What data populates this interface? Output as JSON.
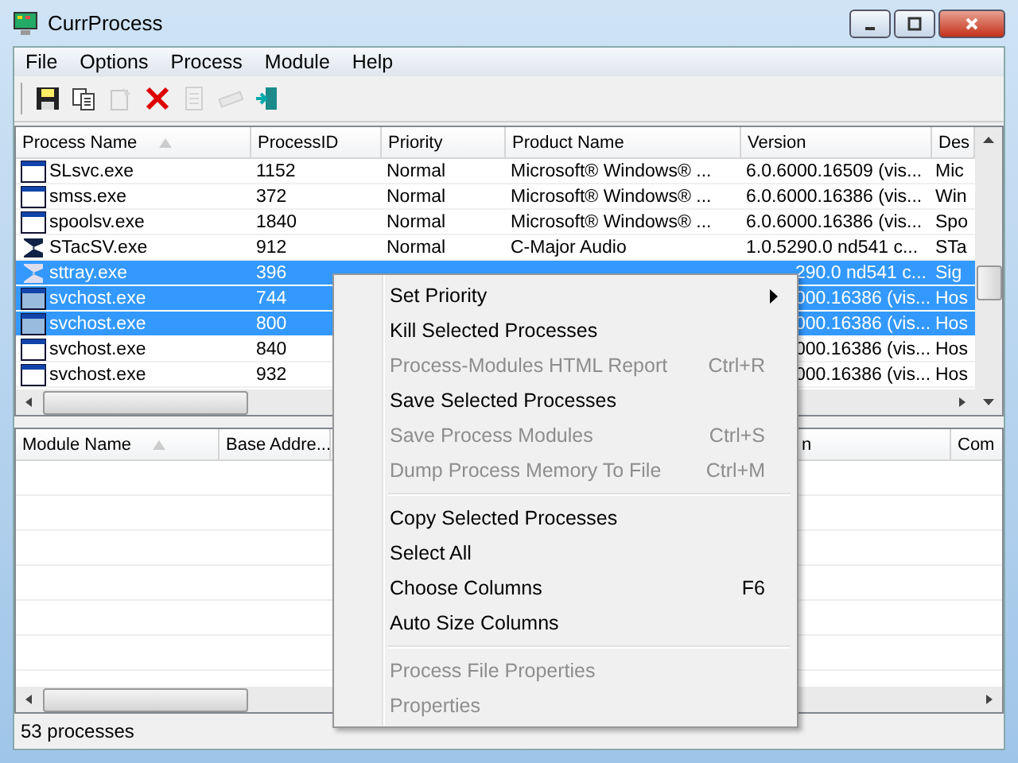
{
  "window": {
    "title": "CurrProcess"
  },
  "menu_bar": [
    "File",
    "Options",
    "Process",
    "Module",
    "Help"
  ],
  "toolbar": [
    {
      "disabled": false
    },
    {
      "disabled": false
    },
    {
      "disabled": true
    },
    {
      "disabled": false
    },
    {
      "disabled": true
    },
    {
      "disabled": true
    },
    {
      "disabled": false
    }
  ],
  "process_table": {
    "columns": [
      {
        "label": "Process Name",
        "sorted": true
      },
      {
        "label": "ProcessID"
      },
      {
        "label": "Priority"
      },
      {
        "label": "Product Name"
      },
      {
        "label": "Version"
      },
      {
        "label": "Des"
      }
    ],
    "rows": [
      {
        "kind": "window",
        "selected": false,
        "covered": false,
        "name": "SLsvc.exe",
        "pid": "1152",
        "priority": "Normal",
        "product": "Microsoft® Windows® ...",
        "version": "6.0.6000.16509 (vis...",
        "description": "Mic"
      },
      {
        "kind": "window",
        "selected": false,
        "covered": false,
        "name": "smss.exe",
        "pid": "372",
        "priority": "Normal",
        "product": "Microsoft® Windows® ...",
        "version": "6.0.6000.16386 (vis...",
        "description": "Win"
      },
      {
        "kind": "window",
        "selected": false,
        "covered": false,
        "name": "spoolsv.exe",
        "pid": "1840",
        "priority": "Normal",
        "product": "Microsoft® Windows® ...",
        "version": "6.0.6000.16386 (vis...",
        "description": "Spo"
      },
      {
        "kind": "sigma",
        "selected": false,
        "covered": false,
        "name": "STacSV.exe",
        "pid": "912",
        "priority": "Normal",
        "product": "C-Major Audio",
        "version": "1.0.5290.0  nd541 c...",
        "description": "STa"
      },
      {
        "kind": "sigma",
        "selected": true,
        "covered": true,
        "name": "sttray.exe",
        "pid": "396",
        "version": "290.0  nd541 c...",
        "description": "Sig"
      },
      {
        "kind": "window",
        "selected": true,
        "covered": true,
        "name": "svchost.exe",
        "pid": "744",
        "version": "000.16386 (vis...",
        "description": "Hos"
      },
      {
        "kind": "window",
        "selected": true,
        "covered": true,
        "name": "svchost.exe",
        "pid": "800",
        "version": "000.16386 (vis...",
        "description": "Hos"
      },
      {
        "kind": "window",
        "selected": false,
        "covered": true,
        "name": "svchost.exe",
        "pid": "840",
        "version": "000.16386 (vis...",
        "description": "Hos"
      },
      {
        "kind": "window",
        "selected": false,
        "covered": true,
        "name": "svchost.exe",
        "pid": "932",
        "version": "000.16386 (vis...",
        "description": "Hos"
      }
    ]
  },
  "module_table": {
    "columns": [
      {
        "label": "Module Name",
        "sorted": true
      },
      {
        "label": "Base Addre..."
      },
      {},
      {
        "label": "n"
      },
      {
        "label": "Com"
      }
    ]
  },
  "context_menu": [
    {
      "kind": "item",
      "label": "Set Priority",
      "disabled": false,
      "submenu": true
    },
    {
      "kind": "item",
      "label": "Kill Selected Processes",
      "disabled": false,
      "submenu": false
    },
    {
      "kind": "item",
      "label": "Process-Modules HTML Report",
      "shortcut": "Ctrl+R",
      "disabled": true,
      "submenu": false
    },
    {
      "kind": "item",
      "label": "Save Selected Processes",
      "disabled": false,
      "submenu": false
    },
    {
      "kind": "item",
      "label": "Save Process Modules",
      "shortcut": "Ctrl+S",
      "disabled": true,
      "submenu": false
    },
    {
      "kind": "item",
      "label": "Dump Process Memory To File",
      "shortcut": "Ctrl+M",
      "disabled": true,
      "submenu": false
    },
    {
      "kind": "separator"
    },
    {
      "kind": "item",
      "label": "Copy Selected Processes",
      "disabled": false,
      "submenu": false
    },
    {
      "kind": "item",
      "label": "Select All",
      "disabled": false,
      "submenu": false
    },
    {
      "kind": "item",
      "label": "Choose Columns",
      "shortcut": "F6",
      "disabled": false,
      "submenu": false
    },
    {
      "kind": "item",
      "label": "Auto Size Columns",
      "disabled": false,
      "submenu": false
    },
    {
      "kind": "separator"
    },
    {
      "kind": "item",
      "label": "Process File Properties",
      "disabled": true,
      "submenu": false
    },
    {
      "kind": "item",
      "label": "Properties",
      "disabled": true,
      "submenu": false
    }
  ],
  "status_bar": "53 processes"
}
